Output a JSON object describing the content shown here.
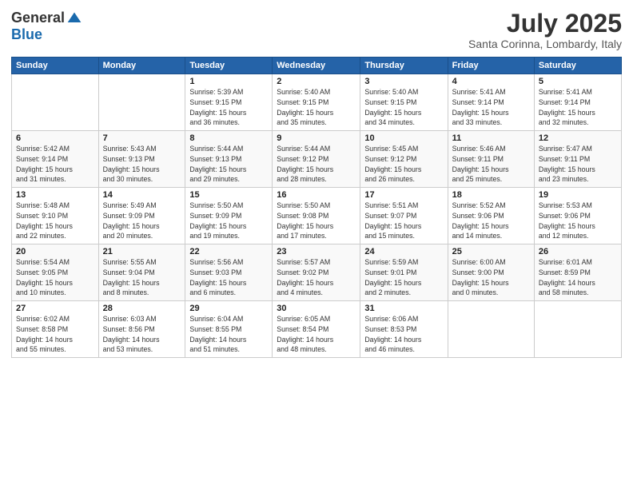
{
  "header": {
    "logo_general": "General",
    "logo_blue": "Blue",
    "title": "July 2025",
    "location": "Santa Corinna, Lombardy, Italy"
  },
  "days_of_week": [
    "Sunday",
    "Monday",
    "Tuesday",
    "Wednesday",
    "Thursday",
    "Friday",
    "Saturday"
  ],
  "weeks": [
    [
      {
        "day": "",
        "info": ""
      },
      {
        "day": "",
        "info": ""
      },
      {
        "day": "1",
        "info": "Sunrise: 5:39 AM\nSunset: 9:15 PM\nDaylight: 15 hours\nand 36 minutes."
      },
      {
        "day": "2",
        "info": "Sunrise: 5:40 AM\nSunset: 9:15 PM\nDaylight: 15 hours\nand 35 minutes."
      },
      {
        "day": "3",
        "info": "Sunrise: 5:40 AM\nSunset: 9:15 PM\nDaylight: 15 hours\nand 34 minutes."
      },
      {
        "day": "4",
        "info": "Sunrise: 5:41 AM\nSunset: 9:14 PM\nDaylight: 15 hours\nand 33 minutes."
      },
      {
        "day": "5",
        "info": "Sunrise: 5:41 AM\nSunset: 9:14 PM\nDaylight: 15 hours\nand 32 minutes."
      }
    ],
    [
      {
        "day": "6",
        "info": "Sunrise: 5:42 AM\nSunset: 9:14 PM\nDaylight: 15 hours\nand 31 minutes."
      },
      {
        "day": "7",
        "info": "Sunrise: 5:43 AM\nSunset: 9:13 PM\nDaylight: 15 hours\nand 30 minutes."
      },
      {
        "day": "8",
        "info": "Sunrise: 5:44 AM\nSunset: 9:13 PM\nDaylight: 15 hours\nand 29 minutes."
      },
      {
        "day": "9",
        "info": "Sunrise: 5:44 AM\nSunset: 9:12 PM\nDaylight: 15 hours\nand 28 minutes."
      },
      {
        "day": "10",
        "info": "Sunrise: 5:45 AM\nSunset: 9:12 PM\nDaylight: 15 hours\nand 26 minutes."
      },
      {
        "day": "11",
        "info": "Sunrise: 5:46 AM\nSunset: 9:11 PM\nDaylight: 15 hours\nand 25 minutes."
      },
      {
        "day": "12",
        "info": "Sunrise: 5:47 AM\nSunset: 9:11 PM\nDaylight: 15 hours\nand 23 minutes."
      }
    ],
    [
      {
        "day": "13",
        "info": "Sunrise: 5:48 AM\nSunset: 9:10 PM\nDaylight: 15 hours\nand 22 minutes."
      },
      {
        "day": "14",
        "info": "Sunrise: 5:49 AM\nSunset: 9:09 PM\nDaylight: 15 hours\nand 20 minutes."
      },
      {
        "day": "15",
        "info": "Sunrise: 5:50 AM\nSunset: 9:09 PM\nDaylight: 15 hours\nand 19 minutes."
      },
      {
        "day": "16",
        "info": "Sunrise: 5:50 AM\nSunset: 9:08 PM\nDaylight: 15 hours\nand 17 minutes."
      },
      {
        "day": "17",
        "info": "Sunrise: 5:51 AM\nSunset: 9:07 PM\nDaylight: 15 hours\nand 15 minutes."
      },
      {
        "day": "18",
        "info": "Sunrise: 5:52 AM\nSunset: 9:06 PM\nDaylight: 15 hours\nand 14 minutes."
      },
      {
        "day": "19",
        "info": "Sunrise: 5:53 AM\nSunset: 9:06 PM\nDaylight: 15 hours\nand 12 minutes."
      }
    ],
    [
      {
        "day": "20",
        "info": "Sunrise: 5:54 AM\nSunset: 9:05 PM\nDaylight: 15 hours\nand 10 minutes."
      },
      {
        "day": "21",
        "info": "Sunrise: 5:55 AM\nSunset: 9:04 PM\nDaylight: 15 hours\nand 8 minutes."
      },
      {
        "day": "22",
        "info": "Sunrise: 5:56 AM\nSunset: 9:03 PM\nDaylight: 15 hours\nand 6 minutes."
      },
      {
        "day": "23",
        "info": "Sunrise: 5:57 AM\nSunset: 9:02 PM\nDaylight: 15 hours\nand 4 minutes."
      },
      {
        "day": "24",
        "info": "Sunrise: 5:59 AM\nSunset: 9:01 PM\nDaylight: 15 hours\nand 2 minutes."
      },
      {
        "day": "25",
        "info": "Sunrise: 6:00 AM\nSunset: 9:00 PM\nDaylight: 15 hours\nand 0 minutes."
      },
      {
        "day": "26",
        "info": "Sunrise: 6:01 AM\nSunset: 8:59 PM\nDaylight: 14 hours\nand 58 minutes."
      }
    ],
    [
      {
        "day": "27",
        "info": "Sunrise: 6:02 AM\nSunset: 8:58 PM\nDaylight: 14 hours\nand 55 minutes."
      },
      {
        "day": "28",
        "info": "Sunrise: 6:03 AM\nSunset: 8:56 PM\nDaylight: 14 hours\nand 53 minutes."
      },
      {
        "day": "29",
        "info": "Sunrise: 6:04 AM\nSunset: 8:55 PM\nDaylight: 14 hours\nand 51 minutes."
      },
      {
        "day": "30",
        "info": "Sunrise: 6:05 AM\nSunset: 8:54 PM\nDaylight: 14 hours\nand 48 minutes."
      },
      {
        "day": "31",
        "info": "Sunrise: 6:06 AM\nSunset: 8:53 PM\nDaylight: 14 hours\nand 46 minutes."
      },
      {
        "day": "",
        "info": ""
      },
      {
        "day": "",
        "info": ""
      }
    ]
  ]
}
